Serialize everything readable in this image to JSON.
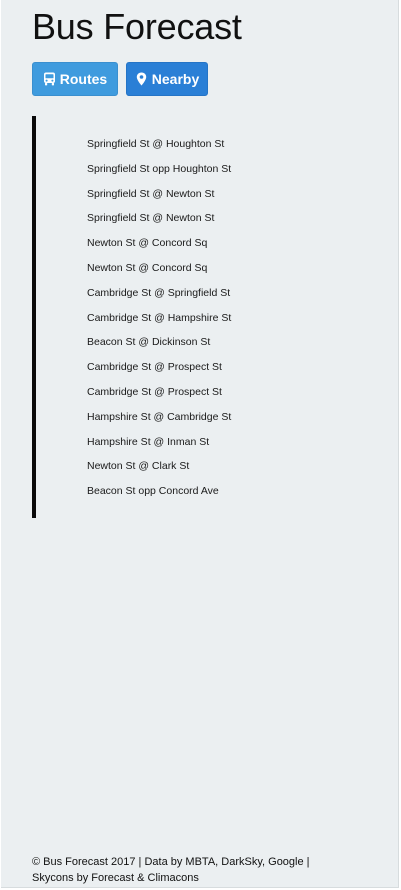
{
  "header": {
    "title": "Bus Forecast"
  },
  "nav": {
    "routes_label": "Routes",
    "nearby_label": "Nearby"
  },
  "stops": [
    "Springfield St @ Houghton St",
    "Springfield St opp Houghton St",
    "Springfield St @ Newton St",
    "Springfield St @ Newton St",
    "Newton St @ Concord Sq",
    "Newton St @ Concord Sq",
    "Cambridge St @ Springfield St",
    "Cambridge St @ Hampshire St",
    "Beacon St @ Dickinson St",
    "Cambridge St @ Prospect St",
    "Cambridge St @ Prospect St",
    "Hampshire St @ Cambridge St",
    "Hampshire St @ Inman St",
    "Newton St @ Clark St",
    "Beacon St opp Concord Ave"
  ],
  "footer": {
    "line1": "© Bus Forecast 2017 | Data by MBTA, DarkSky, Google |",
    "line2": "Skycons by Forecast & Climacons"
  },
  "icons": {
    "routes": "bus-icon",
    "nearby": "map-marker-icon"
  },
  "colors": {
    "background": "#ebeff1",
    "routes_button": "#3f9bde",
    "nearby_button": "#2a7fd6",
    "list_border": "#0a0a0a"
  }
}
